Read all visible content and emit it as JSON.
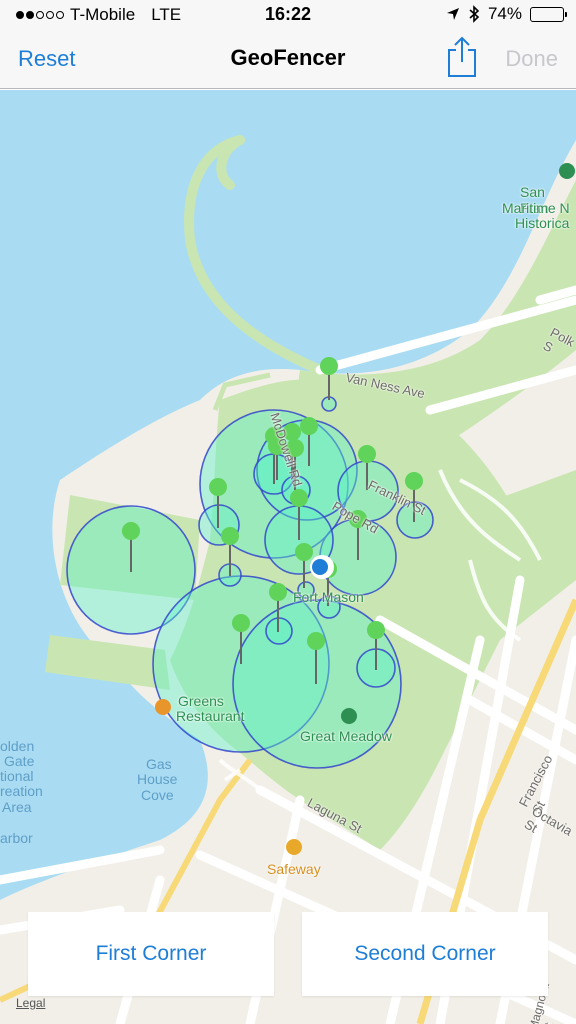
{
  "status_bar": {
    "carrier": "T-Mobile",
    "network": "LTE",
    "time": "16:22",
    "battery": "74%",
    "battery_level": 0.74
  },
  "nav": {
    "left_button": "Reset",
    "title": "GeoFencer",
    "right_button": "Done"
  },
  "map": {
    "labels": {
      "van_ness": "Van Ness Ave",
      "mcdowell": "McDowell Rd",
      "franklin": "Franklin St",
      "pope": "Pope Rd",
      "fort_mason": "Fort Mason",
      "greens_1": "Greens",
      "greens_2": "Restaurant",
      "great_meadow": "Great Meadow",
      "gas_house_1": "Gas",
      "gas_house_2": "House",
      "gas_house_3": "Cove",
      "laguna": "Laguna St",
      "safeway": "Safeway",
      "francisco": "Francisco St",
      "octavia": "Octavia St",
      "polk": "Polk S",
      "maritime_1": "San Fran",
      "maritime_2": "Maritime N",
      "maritime_3": "Historica",
      "golden_gate_1": "olden",
      "golden_gate_2": "Gate",
      "golden_gate_3": "tional",
      "golden_gate_4": "reation",
      "golden_gate_5": "Area",
      "golden_gate_6": "arbor",
      "magnolia": "Magnolia St",
      "legal": "Legal"
    },
    "colors": {
      "water": "#a9dcf2",
      "park": "#c9e6b2",
      "land": "#f2efe8",
      "fence_fill": "#5ef0c8",
      "fence_stroke": "#3344cc",
      "pin": "#5fd35a"
    }
  },
  "buttons": {
    "first_corner": "First Corner",
    "second_corner": "Second Corner"
  }
}
